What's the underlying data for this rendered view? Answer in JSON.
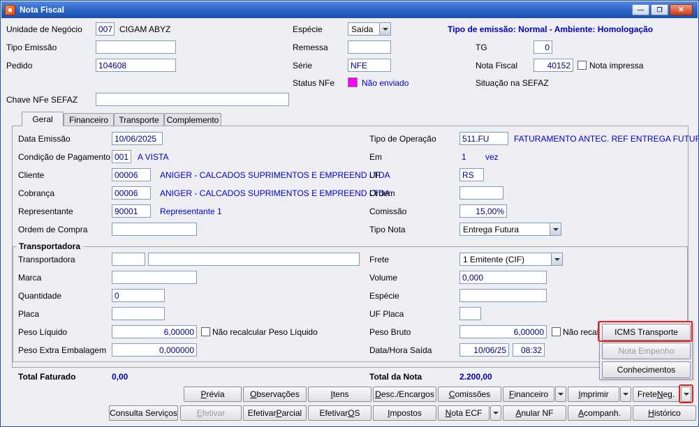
{
  "window": {
    "title": "Nota Fiscal",
    "icons": {
      "minimize": "—",
      "maximize": "❐",
      "close": "✕"
    }
  },
  "colors": {
    "value_blue": "#00008f",
    "desc_blue": "#0000d0",
    "info_blue": "#0000c8",
    "status_magenta": "#ff00ff",
    "annotation_red": "#e2201d",
    "titlebar_blue": "#2a63c4"
  },
  "header": {
    "unidade_negocio": {
      "label": "Unidade de Negócio",
      "code": "007",
      "name": "CIGAM ABYZ"
    },
    "especie": {
      "label": "Espécie",
      "value": "Saída"
    },
    "emissao_info": "Tipo de emissão: Normal - Ambiente: Homologação",
    "tipo_emissao": {
      "label": "Tipo Emissão",
      "value": ""
    },
    "remessa": {
      "label": "Remessa",
      "value": ""
    },
    "tg": {
      "label": "TG",
      "value": "0"
    },
    "pedido": {
      "label": "Pedido",
      "value": "104608"
    },
    "serie": {
      "label": "Série",
      "value": "NFE"
    },
    "nota_fiscal": {
      "label": "Nota Fiscal",
      "value": "40152"
    },
    "nota_impressa": {
      "label": "Nota impressa",
      "checked": false
    },
    "status_nfe": {
      "label": "Status NFe",
      "value": "Não enviado"
    },
    "situacao_sefaz": {
      "label": "Situação na SEFAZ",
      "value": ""
    },
    "chave_nfe": {
      "label": "Chave NFe SEFAZ",
      "value": ""
    }
  },
  "tabs": [
    {
      "label": "Geral",
      "active": true
    },
    {
      "label": "Financeiro",
      "active": false
    },
    {
      "label": "Transporte",
      "active": false
    },
    {
      "label": "Complemento",
      "active": false
    }
  ],
  "geral": {
    "data_emissao": {
      "label": "Data Emissão",
      "value": "10/06/2025"
    },
    "condicao_pagamento": {
      "label": "Condição de Pagamento",
      "code": "001",
      "desc": "A VISTA"
    },
    "cliente": {
      "label": "Cliente",
      "code": "00006",
      "desc": "ANIGER - CALCADOS SUPRIMENTOS E EMPREEND LTDA"
    },
    "cobranca": {
      "label": "Cobrança",
      "code": "00006",
      "desc": "ANIGER - CALCADOS SUPRIMENTOS E EMPREEND LTDA"
    },
    "representante": {
      "label": "Representante",
      "code": "90001",
      "desc": "Representante 1"
    },
    "ordem_compra": {
      "label": "Ordem de Compra",
      "value": ""
    },
    "tipo_operacao": {
      "label": "Tipo de Operação",
      "code": "511.FU",
      "desc": "FATURAMENTO ANTEC. REF ENTREGA FUTURA"
    },
    "em": {
      "label": "Em",
      "value": "1",
      "suffix": "vez"
    },
    "uf": {
      "label": "UF",
      "value": "RS"
    },
    "ordem": {
      "label": "Ordem",
      "value": ""
    },
    "comissao": {
      "label": "Comissão",
      "value": "15,00%"
    },
    "tipo_nota": {
      "label": "Tipo Nota",
      "value": "Entrega Futura"
    }
  },
  "transportadora": {
    "title": "Transportadora",
    "transportadora": {
      "label": "Transportadora",
      "code": "",
      "name": ""
    },
    "marca": {
      "label": "Marca",
      "value": ""
    },
    "quantidade": {
      "label": "Quantidade",
      "value": "0"
    },
    "placa": {
      "label": "Placa",
      "value": ""
    },
    "peso_liquido": {
      "label": "Peso Líquido",
      "value": "6,00000",
      "checkbox_label": "Não recalcular Peso Líquido",
      "checked": false
    },
    "peso_extra": {
      "label": "Peso Extra Embalagem",
      "value": "0,000000"
    },
    "frete": {
      "label": "Frete",
      "value": "1 Emitente (CIF)"
    },
    "volume": {
      "label": "Volume",
      "value": "0,000"
    },
    "especie": {
      "label": "Espécie",
      "value": ""
    },
    "uf_placa": {
      "label": "UF Placa",
      "value": ""
    },
    "peso_bruto": {
      "label": "Peso Bruto",
      "value": "6,00000",
      "checkbox_label": "Não recalc",
      "checked": false
    },
    "data_hora_saida": {
      "label": "Data/Hora Saída",
      "date": "10/06/25",
      "time": "08:32"
    }
  },
  "popup_menu": {
    "items": [
      {
        "label": "ICMS Transporte",
        "highlighted": true,
        "disabled": false
      },
      {
        "label": "Nota Empenho",
        "highlighted": false,
        "disabled": true
      },
      {
        "label": "Conhecimentos",
        "highlighted": false,
        "disabled": false
      }
    ]
  },
  "totals": {
    "faturado": {
      "label": "Total Faturado",
      "value": "0,00"
    },
    "nota": {
      "label": "Total da Nota",
      "value": "2.200,00"
    }
  },
  "actions_row1": [
    {
      "label": "Prévia",
      "u": 0,
      "split": false
    },
    {
      "label": "Observações",
      "u": 0,
      "split": false
    },
    {
      "label": "Itens",
      "u": 0,
      "split": false
    },
    {
      "label": "Desc./Encargos",
      "u": 0,
      "split": false
    },
    {
      "label": "Comissões",
      "u": 0,
      "split": false
    },
    {
      "label": "Financeiro",
      "u": 0,
      "split": true
    },
    {
      "label": "Imprimir",
      "u": 0,
      "split": true
    },
    {
      "label": "Frete Neg.",
      "u": 6,
      "split": true,
      "arrow_highlighted": true
    }
  ],
  "actions_row2": [
    {
      "label": "Consulta Serviços",
      "u": -1,
      "split": false
    },
    {
      "label": "Efetivar",
      "u": 0,
      "split": false,
      "disabled": true
    },
    {
      "label": "Efetivar Parcial",
      "u": 9,
      "split": false
    },
    {
      "label": "Efetivar OS",
      "u": 9,
      "split": false
    },
    {
      "label": "Impostos",
      "u": 0,
      "split": false
    },
    {
      "label": "Nota ECF",
      "u": 0,
      "split": true
    },
    {
      "label": "Anular NF",
      "u": 0,
      "split": false
    },
    {
      "label": "Acompanh.",
      "u": 0,
      "split": false
    },
    {
      "label": "Histórico",
      "u": 0,
      "split": false
    }
  ]
}
